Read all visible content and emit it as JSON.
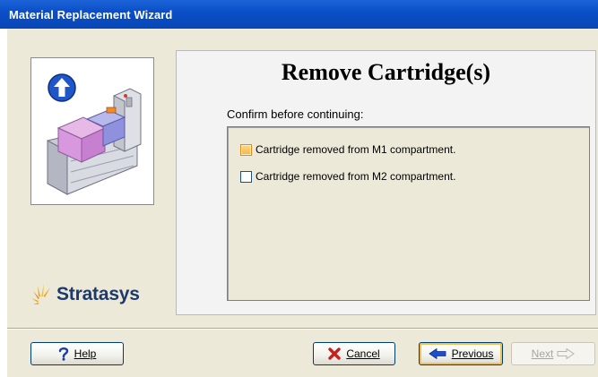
{
  "window": {
    "title": "Material Replacement Wizard"
  },
  "left": {
    "logo_text": "Stratasys"
  },
  "main": {
    "title": "Remove Cartridge(s)",
    "confirm_label": "Confirm before continuing:",
    "items": [
      {
        "label": "Cartridge removed from  M1 compartment.",
        "checked": false,
        "focused": true
      },
      {
        "label": "Cartridge removed from  M2 compartment.",
        "checked": false,
        "focused": false
      }
    ]
  },
  "buttons": {
    "help": "Help",
    "cancel": "Cancel",
    "previous": "Previous",
    "next": "Next"
  },
  "colors": {
    "titlebar": "#0a4fc7",
    "panel_bg": "#ece9d8",
    "focus_check": "#f6b44a",
    "cancel_icon": "#c81e1e",
    "previous_icon": "#1b4fcf",
    "help_icon": "#1a3d9e"
  },
  "icons": {
    "hero": "printer-cartridge-illustration",
    "up_arrow": "up-arrow-circle-icon",
    "logo_mark": "stratasys-burst-icon",
    "help": "question-mark-icon",
    "cancel": "x-mark-icon",
    "previous": "left-arrow-icon",
    "next": "right-arrow-icon"
  }
}
